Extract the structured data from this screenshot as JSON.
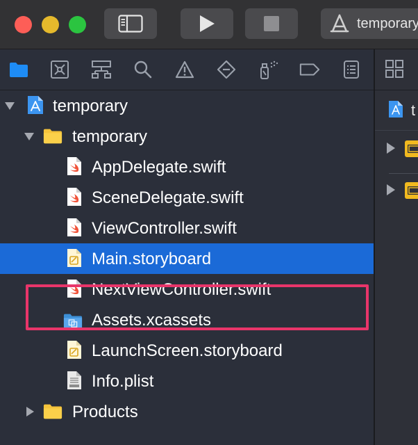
{
  "toolbar": {
    "scheme_name": "temporary",
    "icons": [
      "sidebar-toggle-icon",
      "play-icon",
      "stop-icon",
      "app-scheme-icon"
    ]
  },
  "navigator": {
    "tabs": [
      {
        "name": "project-navigator",
        "icon": "folder-icon",
        "active": true
      },
      {
        "name": "source-control-navigator",
        "icon": "source-control-icon"
      },
      {
        "name": "symbol-navigator",
        "icon": "hierarchy-icon"
      },
      {
        "name": "find-navigator",
        "icon": "magnifier-icon"
      },
      {
        "name": "issue-navigator",
        "icon": "warning-icon"
      },
      {
        "name": "test-navigator",
        "icon": "diamond-icon"
      },
      {
        "name": "debug-navigator",
        "icon": "spray-icon"
      },
      {
        "name": "breakpoint-navigator",
        "icon": "breakpoint-tag-icon"
      },
      {
        "name": "report-navigator",
        "icon": "report-list-icon"
      }
    ],
    "tree": [
      {
        "label": "temporary",
        "type": "project",
        "expanded": true
      },
      {
        "label": "temporary",
        "type": "folder",
        "expanded": true
      },
      {
        "label": "AppDelegate.swift",
        "type": "swift"
      },
      {
        "label": "SceneDelegate.swift",
        "type": "swift"
      },
      {
        "label": "ViewController.swift",
        "type": "swift"
      },
      {
        "label": "Main.storyboard",
        "type": "storyboard",
        "selected": true
      },
      {
        "label": "NextViewController.swift",
        "type": "swift"
      },
      {
        "label": "Assets.xcassets",
        "type": "assets"
      },
      {
        "label": "LaunchScreen.storyboard",
        "type": "storyboard"
      },
      {
        "label": "Info.plist",
        "type": "plist"
      },
      {
        "label": "Products",
        "type": "folder",
        "expanded": false
      }
    ]
  },
  "right_panel": {
    "title_partial": "t"
  },
  "colors": {
    "selection": "#1b6ad7",
    "highlight_box": "#e8356a",
    "folder": "#f5c33b",
    "swift": "#f05138",
    "active_tab": "#1e8cf5"
  }
}
